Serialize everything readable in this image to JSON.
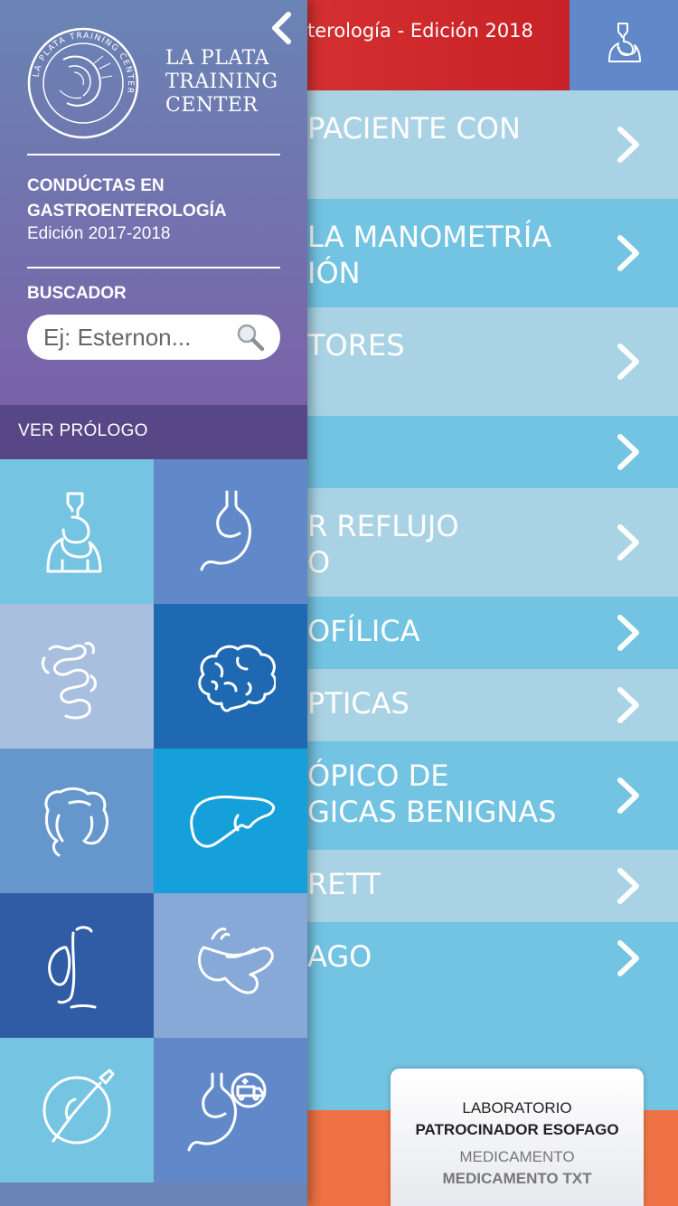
{
  "header": {
    "title": "terología - Edición 2018",
    "icon": "esophagus-icon"
  },
  "menu_items": [
    {
      "line1": "PACIENTE CON",
      "line2": "",
      "shade": "light"
    },
    {
      "line1": "LA MANOMETRÍA",
      "line2": "IÓN",
      "shade": "dark"
    },
    {
      "line1": "TORES",
      "line2": "",
      "shade": "light"
    },
    {
      "line1": "",
      "line2": "",
      "shade": "dark"
    },
    {
      "line1": "R REFLUJO",
      "line2": "O",
      "shade": "light"
    },
    {
      "line1": "OFÍLICA",
      "line2": "",
      "shade": "dark"
    },
    {
      "line1": "PTICAS",
      "line2": "",
      "shade": "light"
    },
    {
      "line1": "ÓPICO DE",
      "line2": "GICAS BENIGNAS",
      "shade": "dark"
    },
    {
      "line1": "RETT",
      "line2": "",
      "shade": "light"
    },
    {
      "line1": "AGO",
      "line2": "",
      "shade": "dark"
    }
  ],
  "sponsor": {
    "line1": "LABORATORIO",
    "line2": "PATROCINADOR ESOFAGO",
    "line3": "MEDICAMENTO",
    "line4": "MEDICAMENTO TXT"
  },
  "drawer": {
    "logo_ring_text": "LA PLATA TRAINING CENTER",
    "logo_line1": "LA PLATA",
    "logo_line2": "TRAINING",
    "logo_line3": "CENTER",
    "book_title": "CONDÚCTAS EN GASTROENTEROLOGÍA",
    "book_edition": "Edición 2017-2018",
    "search_label": "BUSCADOR",
    "search_placeholder": "Ej: Esternon...",
    "prologue_label": "VER PRÓLOGO"
  },
  "grid_tiles": [
    {
      "icon": "esophagus-icon",
      "color": "#74c4e2"
    },
    {
      "icon": "stomach-icon",
      "color": "#6189c9"
    },
    {
      "icon": "small-intestine-icon",
      "color": "#a9bfe0"
    },
    {
      "icon": "brain-icon",
      "color": "#1e69b1"
    },
    {
      "icon": "colon-icon",
      "color": "#6597cc"
    },
    {
      "icon": "liver-icon",
      "color": "#15a0da"
    },
    {
      "icon": "gallbladder-icon",
      "color": "#2f5ca4"
    },
    {
      "icon": "pancreas-icon",
      "color": "#86a9d7"
    },
    {
      "icon": "endoscope-icon",
      "color": "#74c4e2"
    },
    {
      "icon": "stomach-emergency-icon",
      "color": "#6189c9"
    }
  ],
  "colors": {
    "header_red": "#d3272b",
    "light_row": "#a9d3e4",
    "dark_row": "#73c3e2",
    "footer_orange": "#ee7245",
    "prologue_bar": "#574787"
  }
}
